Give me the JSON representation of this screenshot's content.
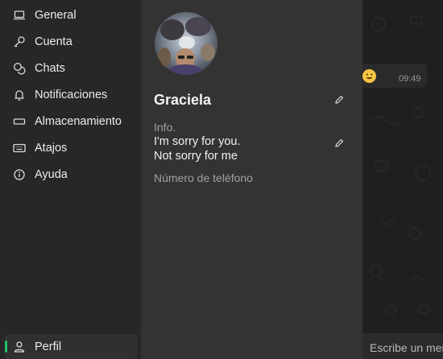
{
  "nav": {
    "items": [
      {
        "label": "General",
        "icon": "laptop-icon"
      },
      {
        "label": "Cuenta",
        "icon": "key-icon"
      },
      {
        "label": "Chats",
        "icon": "chat-bubbles-icon"
      },
      {
        "label": "Notificaciones",
        "icon": "bell-icon"
      },
      {
        "label": "Almacenamiento",
        "icon": "storage-icon"
      },
      {
        "label": "Atajos",
        "icon": "keyboard-icon"
      },
      {
        "label": "Ayuda",
        "icon": "info-icon"
      }
    ],
    "profile": {
      "label": "Perfil",
      "icon": "person-icon",
      "active": true
    }
  },
  "profile": {
    "name": "Graciela",
    "info_label": "Info.",
    "info_text": "I'm sorry for you.\nNot sorry for me",
    "phone_label": "Número de teléfono"
  },
  "chat": {
    "message_time": "09:49",
    "message_emoji": "grinning-face-emoji",
    "composer_placeholder": "Escribe un mensaje"
  },
  "colors": {
    "accent": "#21c063",
    "nav_bg": "#272727",
    "panel_bg": "#333333",
    "chat_bg": "#1f1f1f"
  }
}
